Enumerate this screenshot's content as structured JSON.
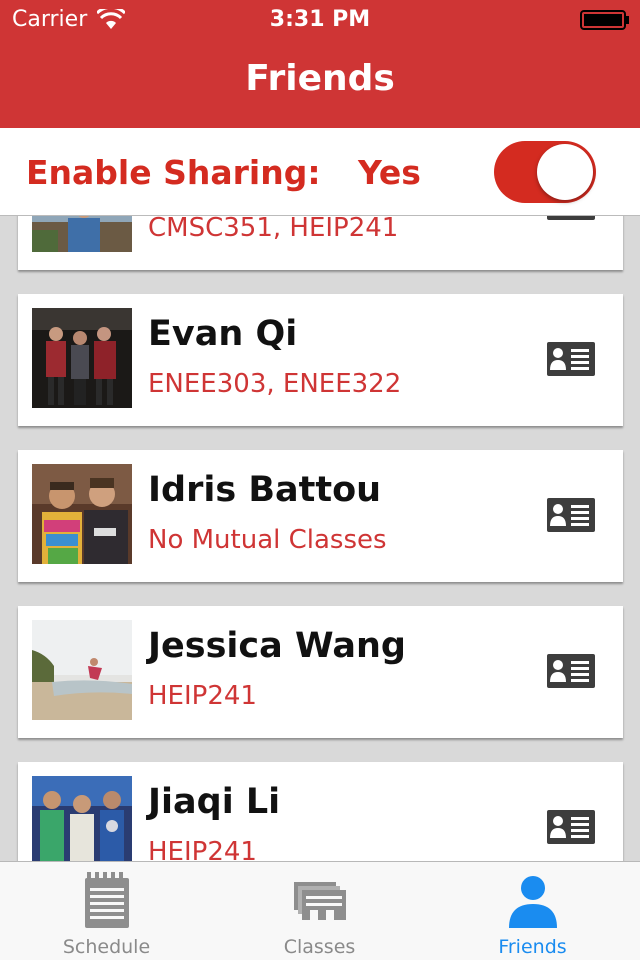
{
  "status_bar": {
    "carrier": "Carrier",
    "time": "3:31 PM"
  },
  "nav": {
    "title": "Friends"
  },
  "sharing": {
    "label": "Enable Sharing:",
    "value": "Yes",
    "toggle_on": true,
    "accent": "#d42b20"
  },
  "friends": [
    {
      "name": "",
      "classes": "CMSC351, HEIP241",
      "action_icon": "contact-card-icon"
    },
    {
      "name": "Evan Qi",
      "classes": "ENEE303, ENEE322",
      "action_icon": "contact-card-icon"
    },
    {
      "name": "Idris Battou",
      "classes": "No Mutual Classes",
      "action_icon": "contact-card-icon"
    },
    {
      "name": "Jessica Wang",
      "classes": "HEIP241",
      "action_icon": "contact-card-icon"
    },
    {
      "name": "Jiaqi Li",
      "classes": "HEIP241",
      "action_icon": "contact-card-icon"
    }
  ],
  "tabs": [
    {
      "label": "Schedule",
      "icon": "notepad-icon",
      "active": false
    },
    {
      "label": "Classes",
      "icon": "classes-icon",
      "active": false
    },
    {
      "label": "Friends",
      "icon": "person-icon",
      "active": true
    }
  ],
  "colors": {
    "header": "#cf3535",
    "tab_active": "#1a8cf0",
    "tab_inactive": "#8a8a8a"
  }
}
